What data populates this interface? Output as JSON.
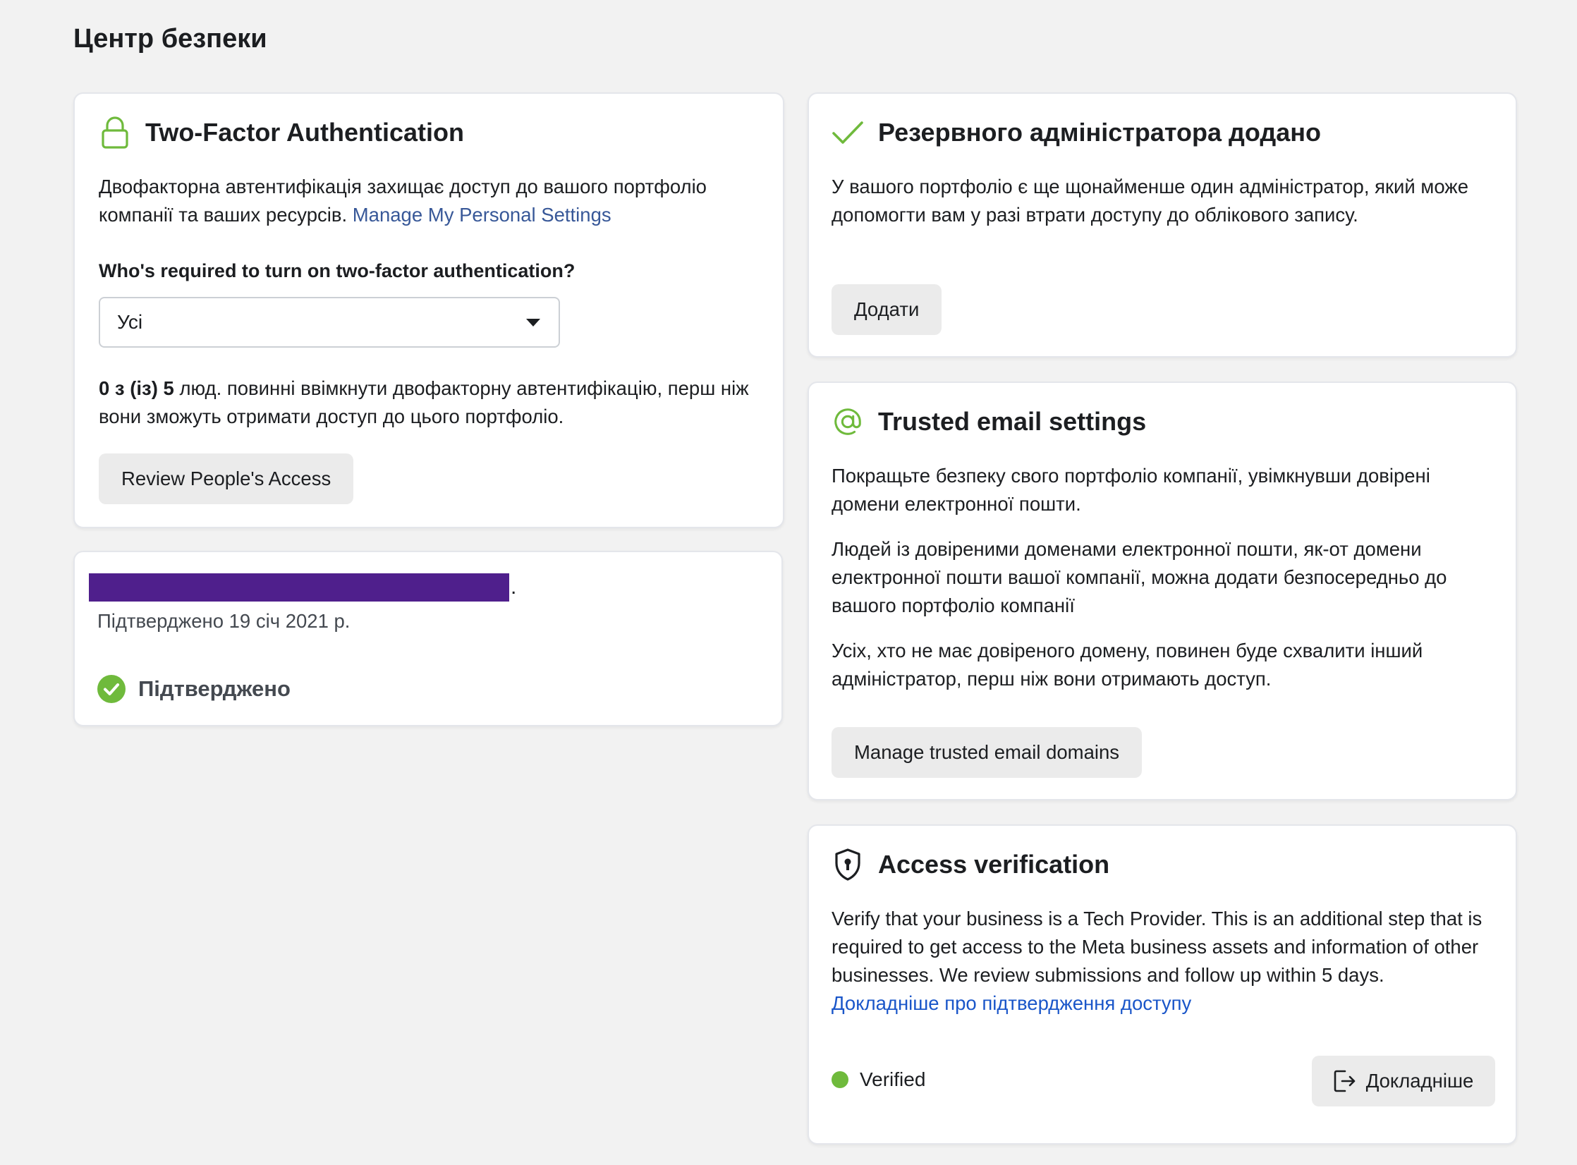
{
  "page": {
    "title": "Центр безпеки"
  },
  "two_factor": {
    "icon": "lock-icon",
    "title": "Two-Factor Authentication",
    "description": "Двофакторна автентифікація захищає доступ до вашого портфоліо компанії та ваших ресурсів.",
    "settings_link": "Manage My Personal Settings",
    "question": "Who's required to turn on two-factor authentication?",
    "select_value": "Усі",
    "count_bold": "0 з (із) 5",
    "count_text": "люд. повинні ввімкнути двофакторну автентифікацію, перш ніж вони зможуть отримати доступ до цього портфоліо.",
    "review_button": "Review People's Access"
  },
  "verification": {
    "trailing_char": ".",
    "date_text": "Підтверджено 19 січ 2021 р.",
    "status_label": "Підтверджено",
    "status_icon": "check-circle-icon",
    "status_color": "#6fba3c"
  },
  "backup_admin": {
    "icon": "checkmark-icon",
    "title": "Резервного адміністратора додано",
    "description": "У вашого портфоліо є ще щонайменше один адміністратор, який може допомогти вам у разі втрати доступу до облікового запису.",
    "add_button": "Додати"
  },
  "trusted_email": {
    "icon": "at-sign-icon",
    "title": "Trusted email settings",
    "paragraph_1": "Покращьте безпеку свого портфоліо компанії, увімкнувши довірені домени електронної пошти.",
    "paragraph_2": "Людей із довіреними доменами електронної пошти, як-от домени електронної пошти вашої компанії, можна додати безпосередньо до вашого портфоліо компанії",
    "paragraph_3": "Усіх, хто не має довіреного домену, повинен буде схвалити інший адміністратор, перш ніж вони отримають доступ.",
    "manage_button": "Manage trusted email domains"
  },
  "access_verification": {
    "icon": "shield-keyhole-icon",
    "title": "Access verification",
    "description": "Verify that your business is a Tech Provider. This is an additional step that is required to get access to the Meta business assets and information of other businesses. We review submissions and follow up within 5 days.",
    "learn_link": "Докладніше про підтвердження доступу",
    "status_label": "Verified",
    "status_color": "#6fba3c",
    "details_button": "Докладніше",
    "details_icon": "external-open-icon"
  },
  "colors": {
    "accent_green": "#6fba3c",
    "link": "#385898",
    "link_blue": "#1a56c9",
    "redaction": "#4f1f8c"
  }
}
